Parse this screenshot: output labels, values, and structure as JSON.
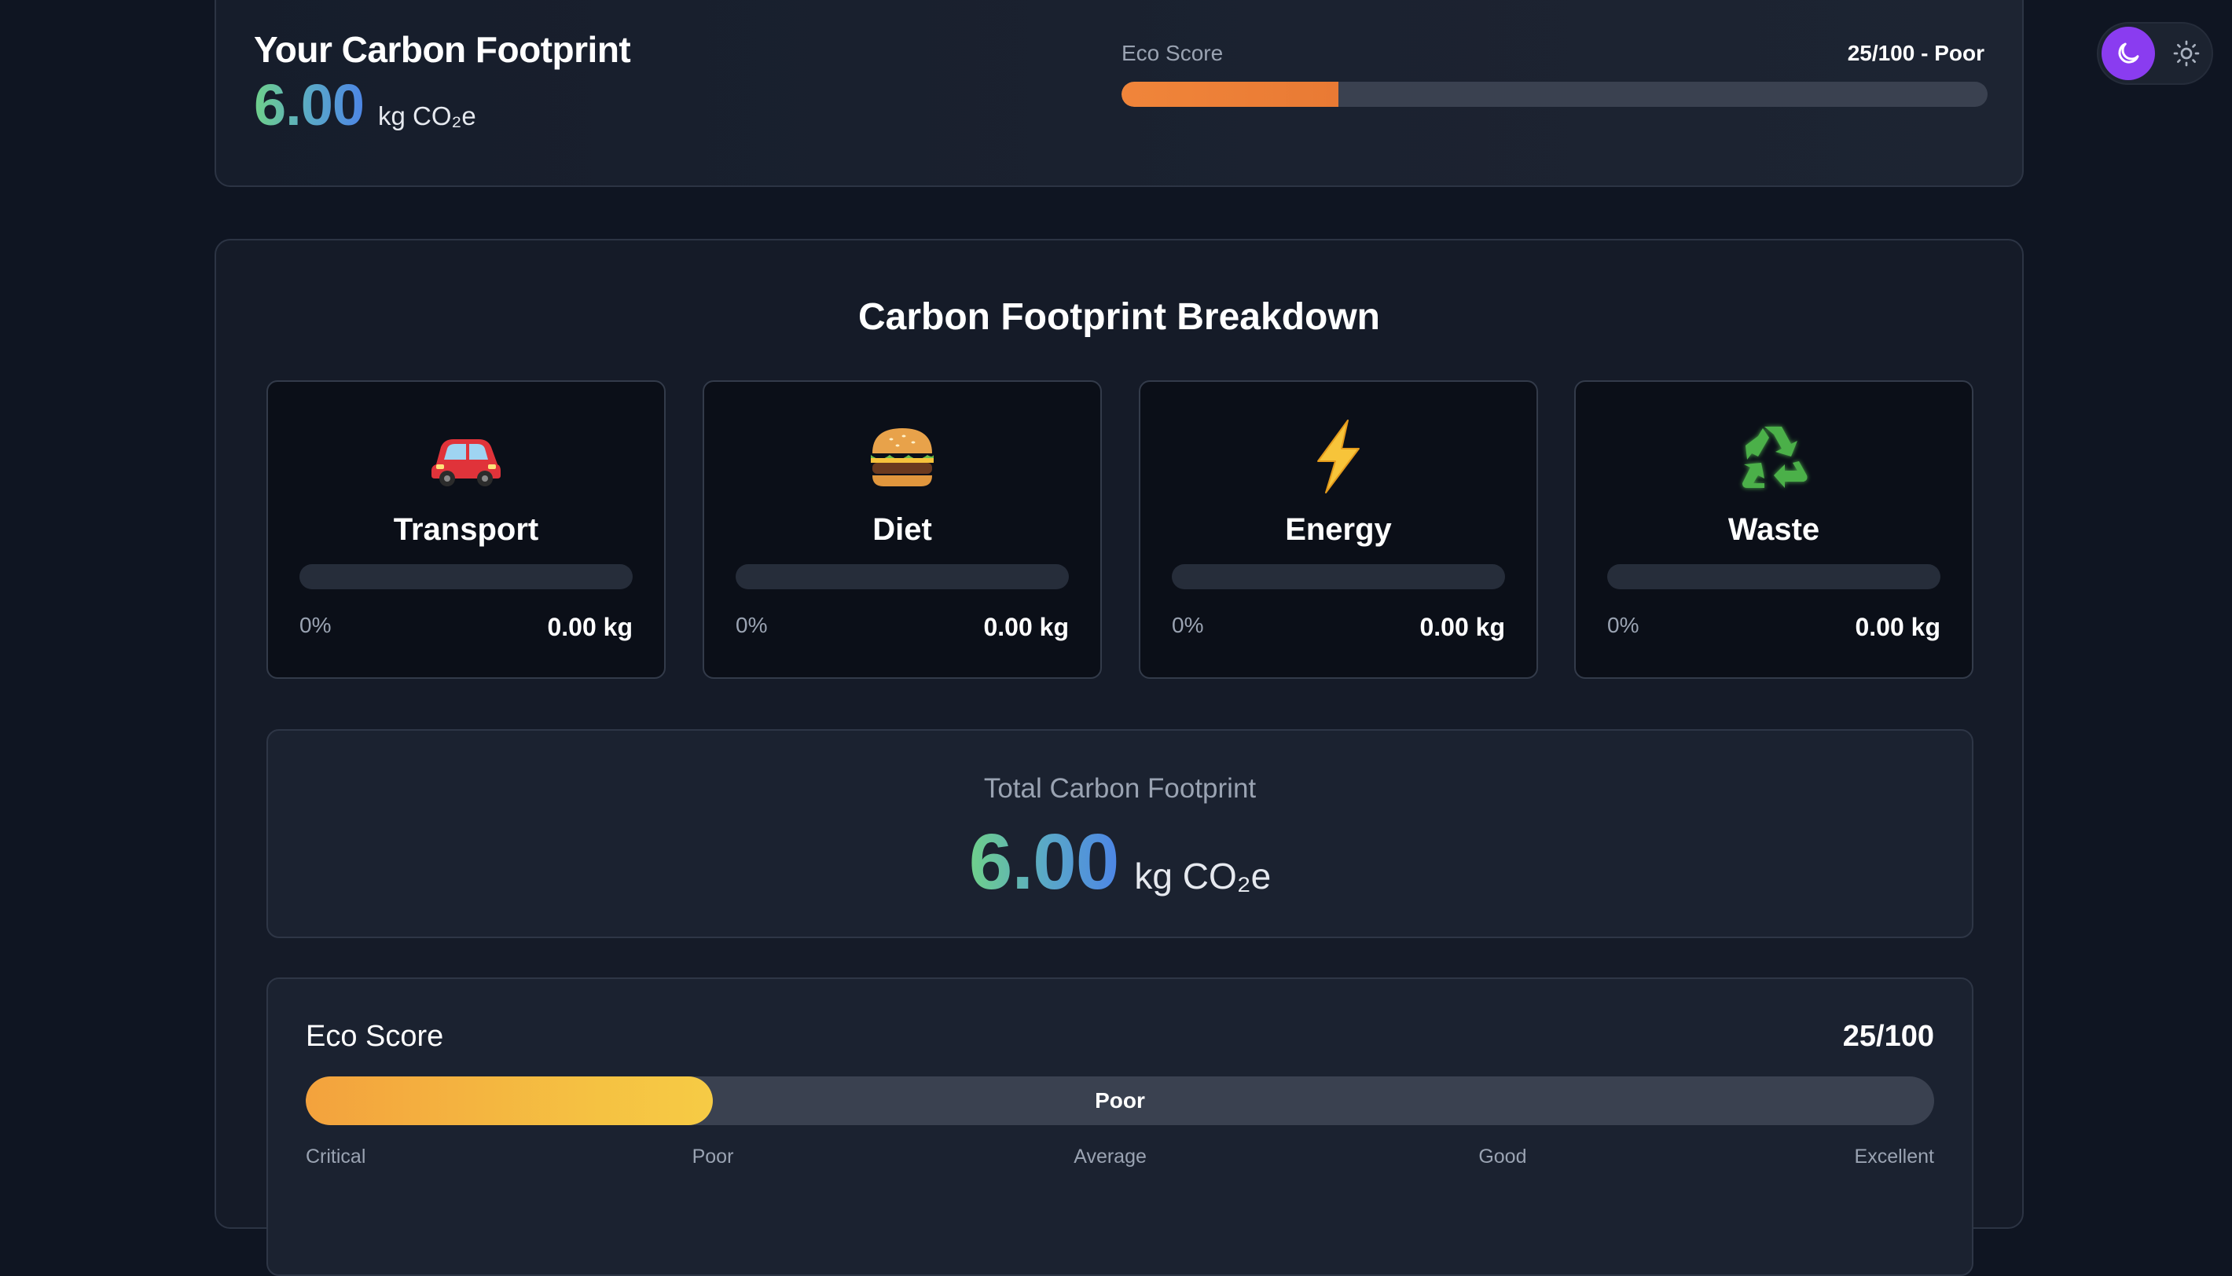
{
  "summary": {
    "title": "Your Carbon Footprint",
    "value": "6.00",
    "unit": "kg CO₂e",
    "eco_label": "Eco Score",
    "eco_score_text": "25/100 - Poor",
    "eco_score_fraction": 0.25
  },
  "theme_toggle": {
    "active": "dark",
    "dark_icon": "moon-icon",
    "light_icon": "sun-icon",
    "active_color": "#8a3cf0"
  },
  "breakdown": {
    "title": "Carbon Footprint Breakdown",
    "categories": [
      {
        "icon": "🚗",
        "icon_name": "car-icon",
        "name": "Transport",
        "percent": "0%",
        "kg": "0.00 kg",
        "fraction": 0
      },
      {
        "icon": "🍔",
        "icon_name": "burger-icon",
        "name": "Diet",
        "percent": "0%",
        "kg": "0.00 kg",
        "fraction": 0
      },
      {
        "icon": "⚡",
        "icon_name": "lightning-icon",
        "name": "Energy",
        "percent": "0%",
        "kg": "0.00 kg",
        "fraction": 0
      },
      {
        "icon": "♻️",
        "icon_name": "recycle-icon",
        "name": "Waste",
        "percent": "0%",
        "kg": "0.00 kg",
        "fraction": 0
      }
    ],
    "total": {
      "label": "Total Carbon Footprint",
      "value": "6.00",
      "unit": "kg CO₂e"
    },
    "eco": {
      "label": "Eco Score",
      "score_text": "25/100",
      "score_fraction": 0.25,
      "rating": "Poor",
      "scale": [
        "Critical",
        "Poor",
        "Average",
        "Good",
        "Excellent"
      ]
    }
  },
  "colors": {
    "background": "#0f1522",
    "accent_orange": "#f0853a",
    "eco_gradient_start": "#f3a23d",
    "eco_gradient_end": "#f6cb45",
    "number_gradient_start": "#6fd08a",
    "number_gradient_end": "#4d86e6"
  }
}
